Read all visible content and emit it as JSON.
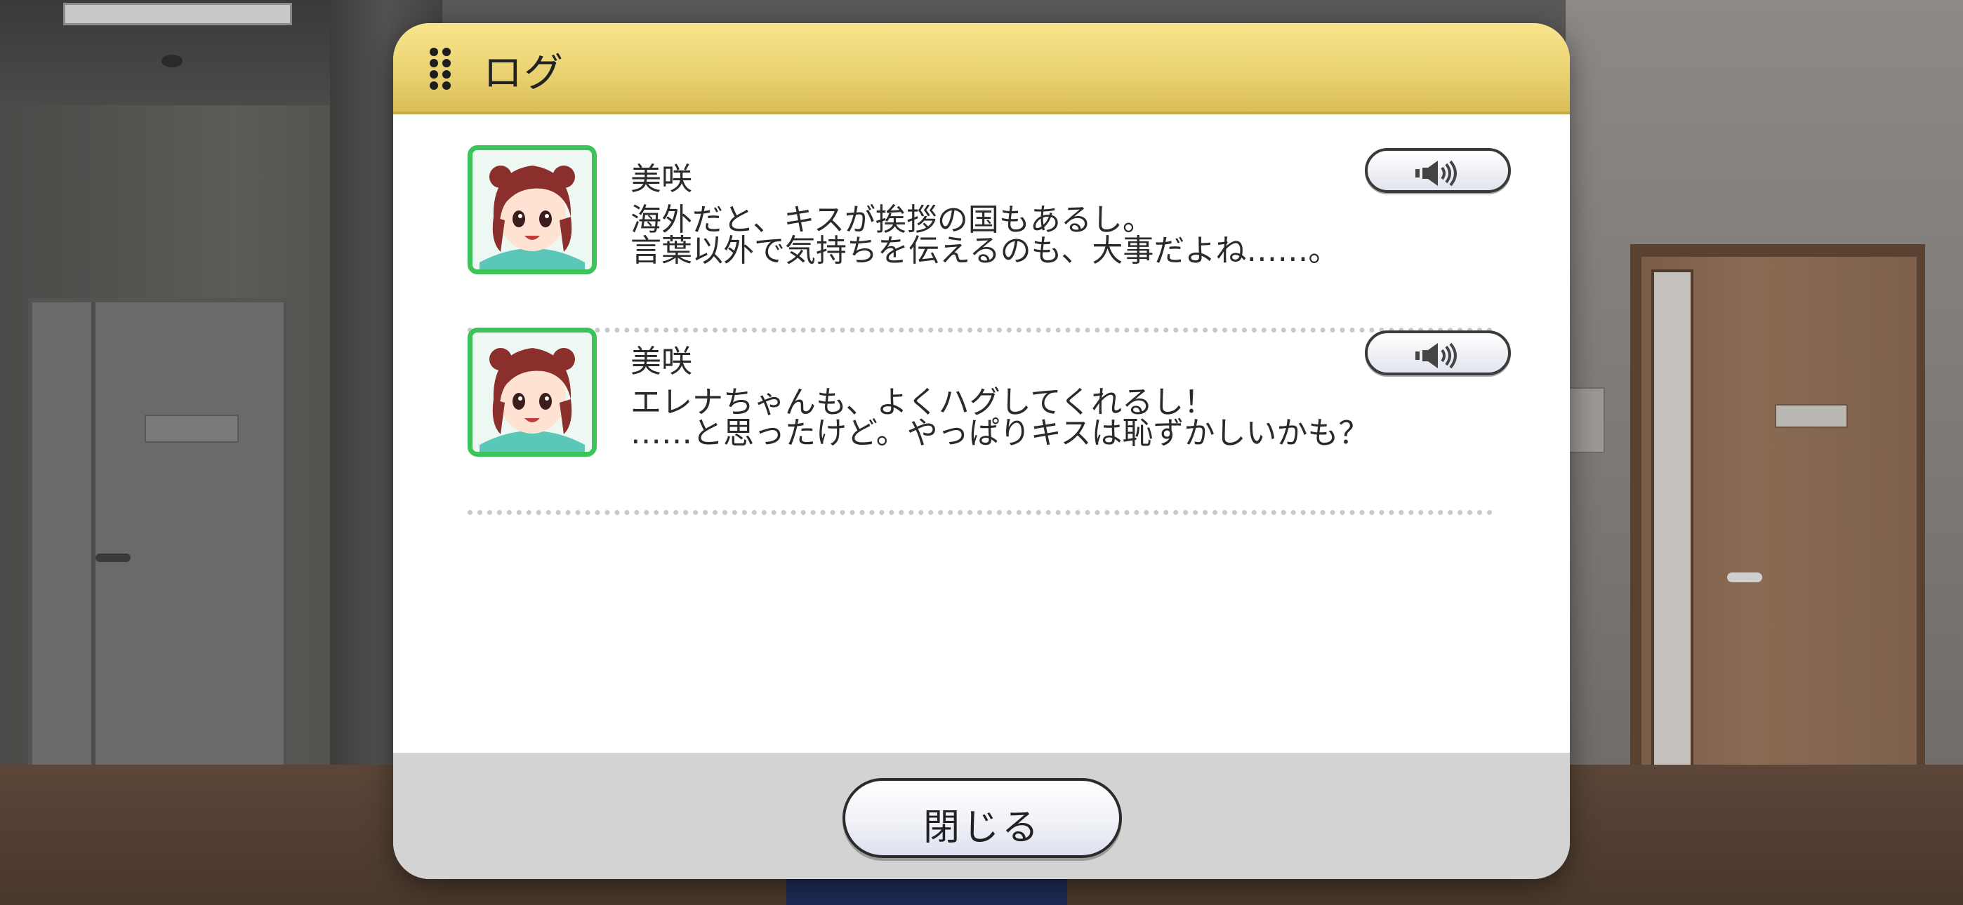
{
  "dialog": {
    "title": "ログ",
    "entries": [
      {
        "speaker": "美咲",
        "line1": "海外だと、キスが挨拶の国もあるし。",
        "line2": "言葉以外で気持ちを伝えるのも、大事だよね……。",
        "icon": "voice-play-icon"
      },
      {
        "speaker": "美咲",
        "line1": "エレナちゃんも、よくハグしてくれるし！",
        "line2": "……と思ったけど。やっぱりキスは恥ずかしいかも？",
        "icon": "voice-play-icon"
      }
    ],
    "close_label": "閉じる"
  },
  "colors": {
    "header": "#e9d170",
    "avatar_border": "#3cc45a",
    "footer": "#d3d3d3"
  }
}
